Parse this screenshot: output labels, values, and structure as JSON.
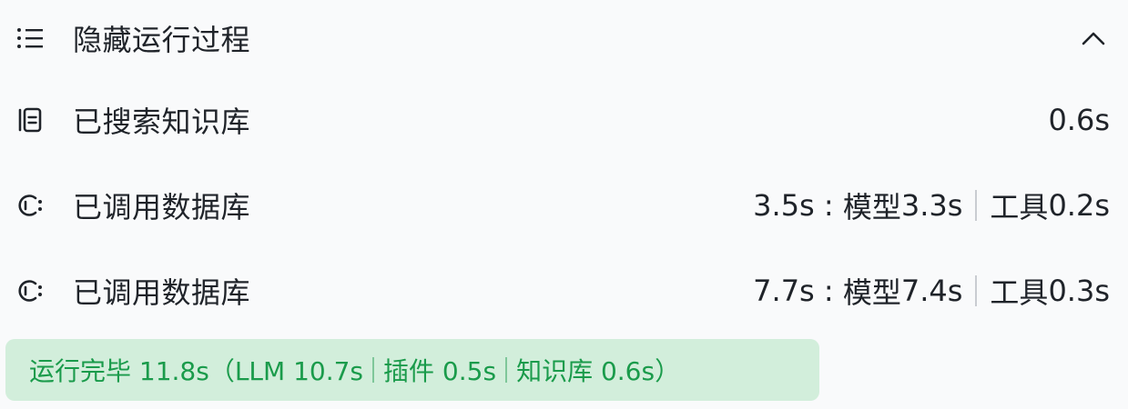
{
  "header": {
    "label": "隐藏运行过程",
    "icons": {
      "list": "list-icon",
      "collapse": "chevron-up-icon"
    }
  },
  "steps": [
    {
      "label": "已搜索知识库",
      "icon": "knowledge-base-icon",
      "time": "0.6s"
    },
    {
      "label": "已调用数据库",
      "icon": "database-call-icon",
      "time": "3.5s",
      "model_label": "模型",
      "model_time": "3.3s",
      "tool_label": "工具",
      "tool_time": "0.2s"
    },
    {
      "label": "已调用数据库",
      "icon": "database-call-icon",
      "time": "7.7s",
      "model_label": "模型",
      "model_time": "7.4s",
      "tool_label": "工具",
      "tool_time": "0.3s"
    }
  ],
  "summary": {
    "prefix": "运行完毕 11.8s（LLM 10.7s",
    "plugin": "插件 0.5s",
    "kb": "知识库 0.6s）",
    "bg_color": "#d2eedb",
    "text_color": "#1a9b4b"
  }
}
